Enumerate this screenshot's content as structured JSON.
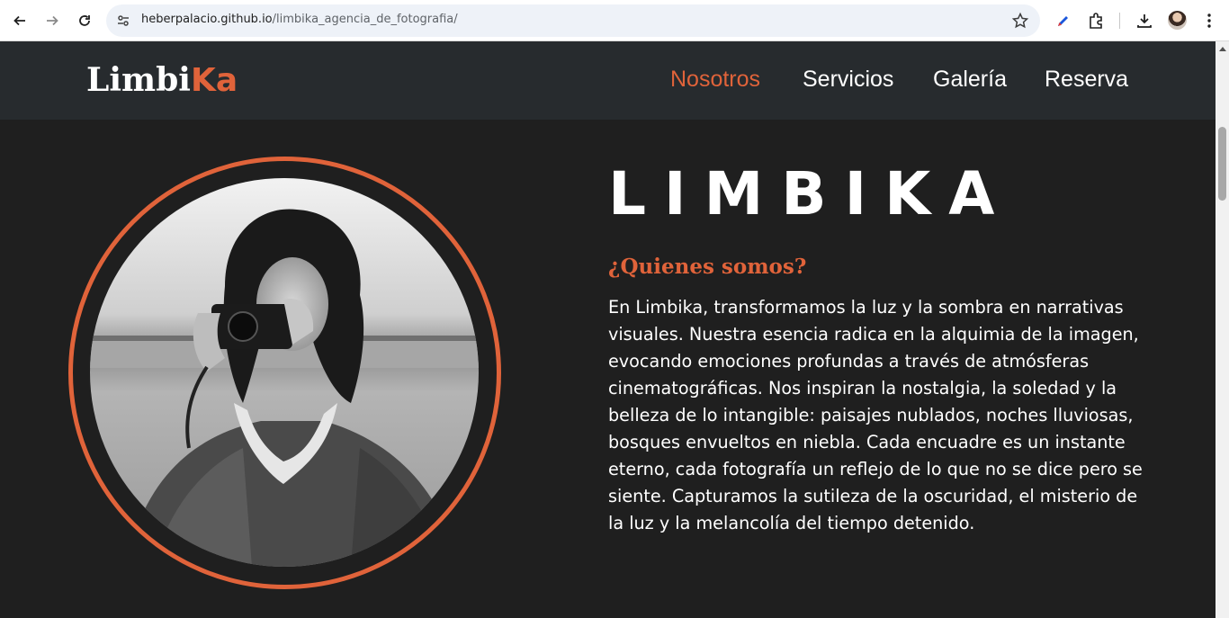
{
  "browser": {
    "url_host": "heberpalacio.github.io",
    "url_path": "/limbika_agencia_de_fotografia/"
  },
  "site": {
    "logo_main": "Limbi",
    "logo_accent": "Ka",
    "nav": [
      {
        "label": "Nosotros",
        "active": true
      },
      {
        "label": "Servicios",
        "active": false
      },
      {
        "label": "Galería",
        "active": false
      },
      {
        "label": "Reserva",
        "active": false
      }
    ]
  },
  "hero": {
    "title": "LIMBIKA",
    "subtitle": "¿Quienes somos?",
    "text": "En Limbika, transformamos la luz y la sombra en narrativas visuales. Nuestra esencia radica en la alquimia de la imagen, evocando emociones profundas a través de atmósferas cinematográficas. Nos inspiran la nostalgia, la soledad y la belleza de lo intangible: paisajes nublados, noches lluviosas, bosques envueltos en niebla. Cada encuadre es un instante eterno, cada fotografía un reflejo de lo que no se dice pero se siente. Capturamos la sutileza de la oscuridad, el misterio de la luz y la melancolía del tiempo detenido."
  },
  "colors": {
    "accent": "#e0633a",
    "header_bg": "#272b2e",
    "page_bg": "#1f1f1f"
  },
  "icons": [
    "back-arrow-icon",
    "forward-arrow-icon",
    "reload-icon",
    "site-info-icon",
    "bookmark-star-icon",
    "pen-extension-icon",
    "extensions-puzzle-icon",
    "download-icon",
    "profile-avatar",
    "kebab-menu-icon"
  ]
}
